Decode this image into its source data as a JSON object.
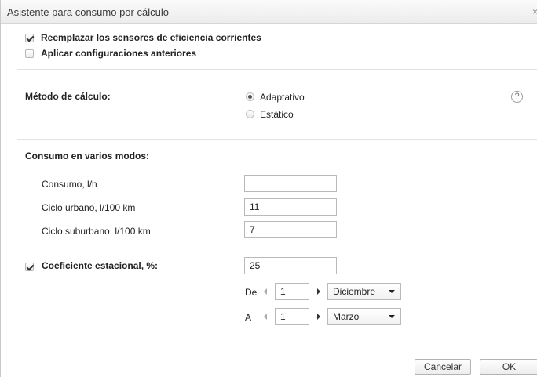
{
  "dialog": {
    "title": "Asistente para consumo por cálculo",
    "close_glyph": "×"
  },
  "options": {
    "replace_sensors": {
      "label": "Reemplazar los sensores de eficiencia corrientes",
      "checked": true
    },
    "apply_previous": {
      "label": "Aplicar configuraciones anteriores",
      "checked": false
    }
  },
  "method": {
    "label": "Método de cálculo:",
    "adaptive": "Adaptativo",
    "static": "Estático",
    "selected": "Adaptativo",
    "help_icon": "question-circle-icon",
    "help_glyph": "?"
  },
  "consumption": {
    "section_label": "Consumo en varios modos:",
    "rows": [
      {
        "label": "Consumo, l/h",
        "value": ""
      },
      {
        "label": "Ciclo urbano, l/100 km",
        "value": "11"
      },
      {
        "label": "Ciclo suburbano, l/100 km",
        "value": "7"
      }
    ]
  },
  "seasonal": {
    "label": "Coeficiente estacional, %:",
    "checked": true,
    "value": "25",
    "from": {
      "label": "De",
      "day": "1",
      "month": "Diciembre"
    },
    "to": {
      "label": "A",
      "day": "1",
      "month": "Marzo"
    }
  },
  "buttons": {
    "cancel": "Cancelar",
    "ok": "OK"
  }
}
